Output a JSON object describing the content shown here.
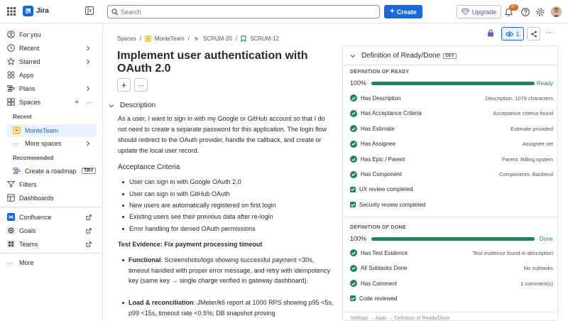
{
  "app": {
    "name": "Jira"
  },
  "topbar": {
    "search_placeholder": "Search",
    "create_label": "Create",
    "upgrade_label": "Upgrade",
    "notifications_badge": "9+"
  },
  "sidebar": {
    "for_you": "For you",
    "recent": "Recent",
    "starred": "Starred",
    "apps": "Apps",
    "plans": "Plans",
    "spaces": "Spaces",
    "recent_label": "Recent",
    "monte_team": "MonteTeam",
    "more_spaces": "More spaces",
    "recommended_label": "Recommended",
    "create_roadmap": "Create a roadmap",
    "try_badge": "TRY",
    "filters": "Filters",
    "dashboards": "Dashboards",
    "confluence": "Confluence",
    "goals": "Goals",
    "teams": "Teams",
    "more": "More"
  },
  "breadcrumbs": {
    "spaces": "Spaces",
    "team": "MonteTeam",
    "parent": "SCRUM-20",
    "issue": "SCRUM-12"
  },
  "issue": {
    "title": "Implement user authentication with OAuth 2.0",
    "description_heading": "Description",
    "description_text": "As a user, I want to sign in with my Google or GitHub account so that I do not need to create a separate password for this application. The login flow should redirect to the OAuth provider, handle the callback, and create or update the local user record.",
    "acceptance_heading": "Acceptance Criteria",
    "criteria": [
      "User can sign in with Google OAuth 2.0",
      "User can sign in with GitHub OAuth",
      "New users are automatically registered on first login",
      "Existing users see their previous data after re-login",
      "Error handling for denied OAuth permissions"
    ],
    "test_evidence_heading": "Test Evidence: Fix payment processing timeout",
    "functional_label": "Functional",
    "functional_text": ": Screenshots/logs showing successful payment <30s, timeout handled with proper error message, and retry with idempotency key (same key → single charge verified in gateway dashboard).",
    "load_label": "Load & reconciliation",
    "load_text": ": JMeter/k6 report at 1000 RPS showing p95 <5s, p99 <15s, timeout rate <0.5%; DB snapshot proving"
  },
  "watchers": {
    "count": "1"
  },
  "panel": {
    "title": "Definition of Ready/Done",
    "dev_badge": "DEV",
    "ready_heading": "DEFINITION OF READY",
    "ready_percent": "100%",
    "ready_percent_value": 100,
    "ready_status": "Ready",
    "ready_items": [
      {
        "label": "Has Description",
        "value": "Description: 1079 characters"
      },
      {
        "label": "Has Acceptance Criteria",
        "value": "Acceptance criteria found"
      },
      {
        "label": "Has Estimate",
        "value": "Estimate provided"
      },
      {
        "label": "Has Assignee",
        "value": "Assignee set"
      },
      {
        "label": "Has Epic / Parent",
        "value": "Parent: Billing system"
      },
      {
        "label": "Has Component",
        "value": "Components: Backend"
      }
    ],
    "ready_checks": [
      "UX review completed",
      "Security review completed"
    ],
    "done_heading": "DEFINITION OF DONE",
    "done_percent": "100%",
    "done_percent_value": 100,
    "done_status": "Done",
    "done_items": [
      {
        "label": "Has Test Evidence",
        "value": "Test evidence found in description"
      },
      {
        "label": "All Subtasks Done",
        "value": "No subtasks"
      },
      {
        "label": "Has Comment",
        "value": "1 comment(s)"
      }
    ],
    "done_checks": [
      "Code reviewed"
    ],
    "footer": "Settings → Apps → Definition of Ready/Done"
  },
  "colors": {
    "accent": "#1868db",
    "success": "#1f845a"
  }
}
